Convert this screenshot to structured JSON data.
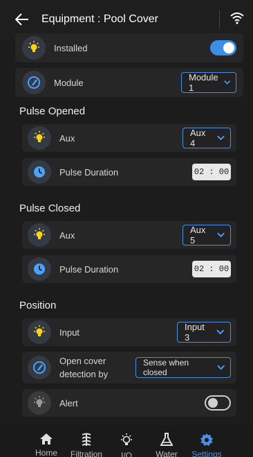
{
  "header": {
    "title": "Equipment : Pool Cover"
  },
  "installed": {
    "label": "Installed",
    "on": true
  },
  "module": {
    "label": "Module",
    "value": "Module 1"
  },
  "pulse_opened": {
    "title": "Pulse Opened",
    "aux_label": "Aux",
    "aux_value": "Aux 4",
    "duration_label": "Pulse Duration",
    "duration_value": "02 : 00"
  },
  "pulse_closed": {
    "title": "Pulse Closed",
    "aux_label": "Aux",
    "aux_value": "Aux 5",
    "duration_label": "Pulse Duration",
    "duration_value": "02 : 00"
  },
  "position": {
    "title": "Position",
    "input_label": "Input",
    "input_value": "Input 3",
    "detection_label": "Open cover detection by",
    "detection_value": "Sense when closed",
    "alert_label": "Alert",
    "alert_on": false
  },
  "nav": {
    "items": [
      {
        "label": "Home",
        "icon": "home-icon"
      },
      {
        "label": "Filtration",
        "icon": "filtration-icon"
      },
      {
        "label": "I/O",
        "icon": "bulb-icon"
      },
      {
        "label": "Water",
        "icon": "flask-icon"
      },
      {
        "label": "Settings",
        "icon": "gear-icon"
      }
    ],
    "active": "Settings"
  },
  "colors": {
    "accent": "#3d8ee6",
    "background": "#1c1c1c",
    "card": "#262626",
    "icon_yellow": "#ffd21f"
  }
}
